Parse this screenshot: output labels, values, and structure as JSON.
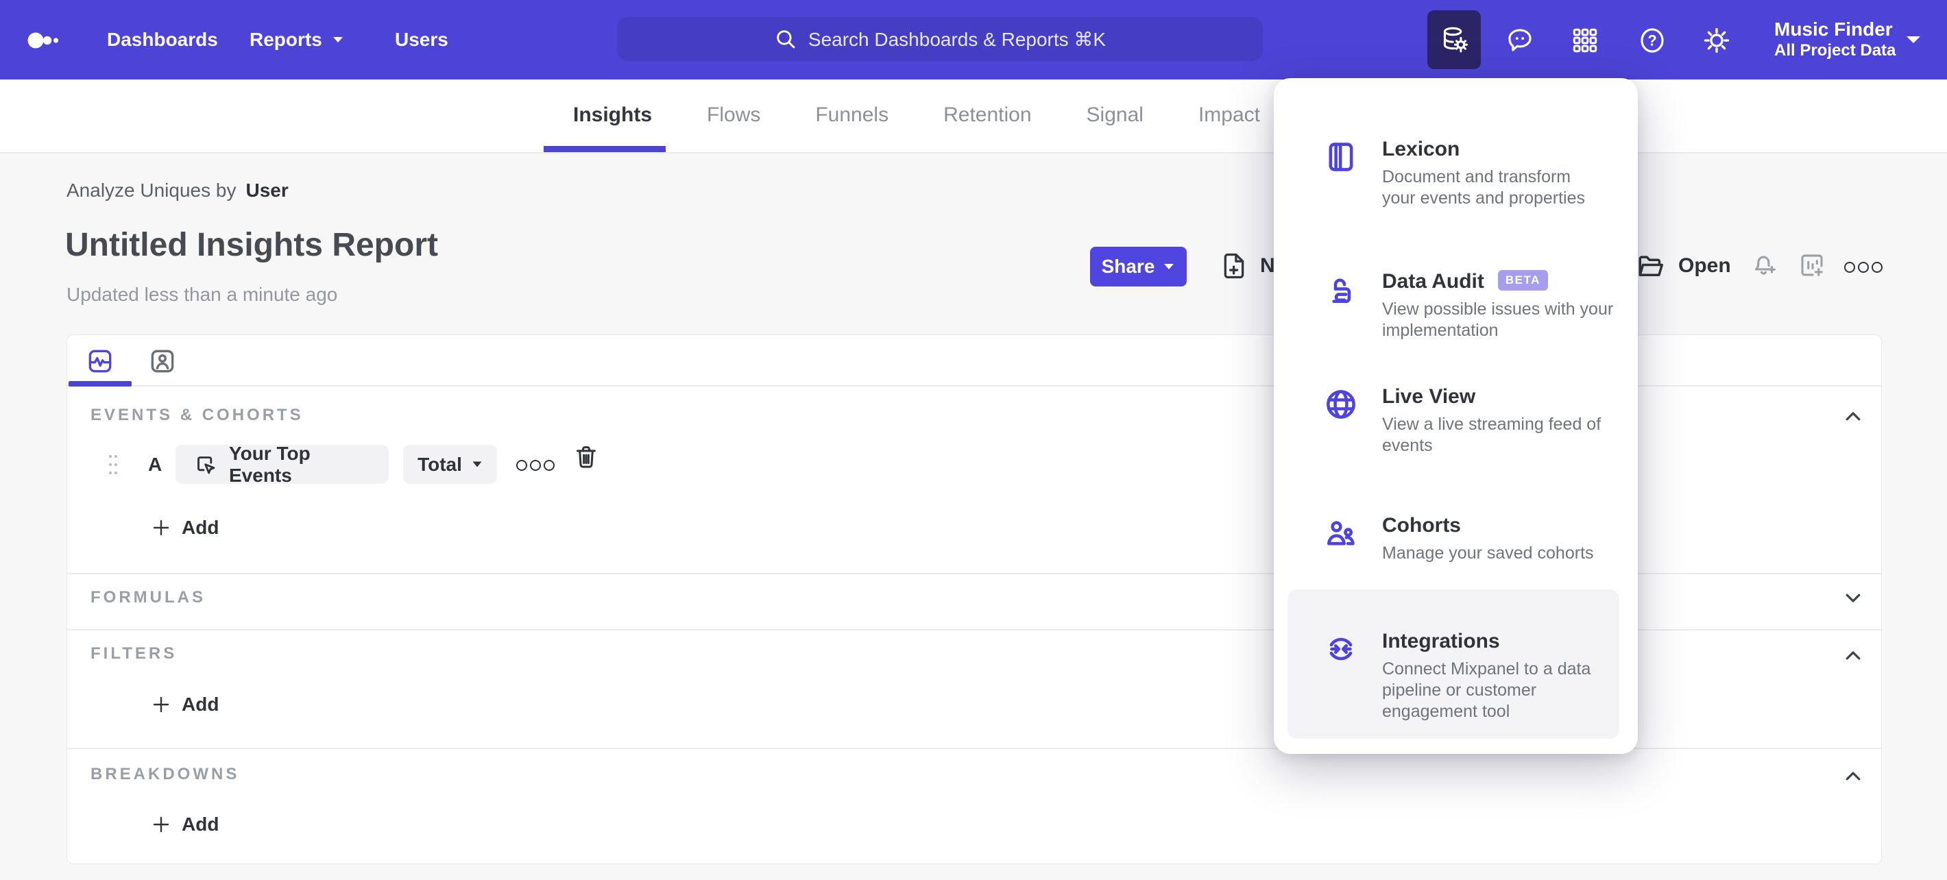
{
  "colors": {
    "topbar_bg": "#4d44d7",
    "search_bg": "#453dc3",
    "active_tile_bg": "#2b2466",
    "accent": "#5145e0",
    "beta_badge_bg": "#a79ded",
    "page_bg": "#f7f7f8"
  },
  "topbar": {
    "logo": "mixpanel-dots",
    "nav": [
      {
        "label": "Dashboards"
      },
      {
        "label": "Reports"
      },
      {
        "label": "Users"
      }
    ],
    "search": {
      "placeholder": "Search Dashboards & Reports ⌘K"
    },
    "project": {
      "name": "Music Finder",
      "scope": "All Project Data"
    }
  },
  "report_tabs": {
    "items": [
      {
        "label": "Insights"
      },
      {
        "label": "Flows"
      },
      {
        "label": "Funnels"
      },
      {
        "label": "Retention"
      },
      {
        "label": "Signal"
      },
      {
        "label": "Impact"
      }
    ],
    "active": "Insights"
  },
  "header": {
    "analyze_prefix": "Analyze Uniques by",
    "analyze_value": "User",
    "title": "Untitled Insights Report",
    "updated": "Updated less than a minute ago",
    "share_label": "Share",
    "new_label": "New",
    "open_label": "Open"
  },
  "builder": {
    "events": {
      "label": "EVENTS & COHORTS",
      "row": {
        "letter": "A",
        "event_name": "Your Top Events",
        "metric": "Total"
      },
      "add_label": "Add"
    },
    "formulas": {
      "label": "FORMULAS"
    },
    "filters": {
      "label": "FILTERS",
      "add_label": "Add"
    },
    "breakdowns": {
      "label": "BREAKDOWNS",
      "add_label": "Add"
    }
  },
  "menu": {
    "items": [
      {
        "title": "Lexicon",
        "icon": "book-icon",
        "description": "Document and transform\nyour events and properties"
      },
      {
        "title": "Data Audit",
        "icon": "lock-icon",
        "badge": "BETA",
        "description": "View possible issues with your\nimplementation"
      },
      {
        "title": "Live View",
        "icon": "globe-icon",
        "description": "View a live streaming feed of\nevents"
      },
      {
        "title": "Cohorts",
        "icon": "cohorts-icon",
        "description": "Manage your saved cohorts"
      },
      {
        "title": "Integrations",
        "icon": "integrations-icon",
        "highlighted": true,
        "description": "Connect Mixpanel to a data\npipeline or customer\nengagement tool"
      }
    ]
  }
}
